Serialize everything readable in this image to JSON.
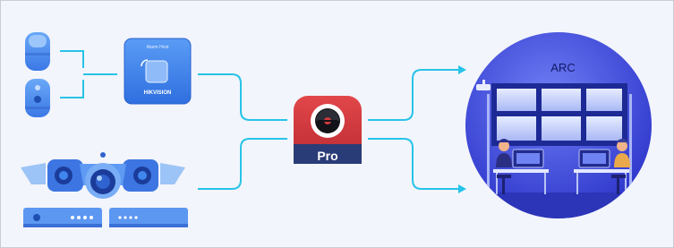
{
  "alarm_host": {
    "title": "Alarm Host",
    "brand": "HIKVISION"
  },
  "app_icon": {
    "badge": "Pro",
    "icon": "camera-shutter-icon"
  },
  "arc": {
    "label": "ARC"
  },
  "colors": {
    "connector": "#27c3e8",
    "device_blue": "#3f86ef",
    "app_red": "#d4383d",
    "arc_blue": "#3a45d8",
    "background": "#f3f5fc"
  }
}
